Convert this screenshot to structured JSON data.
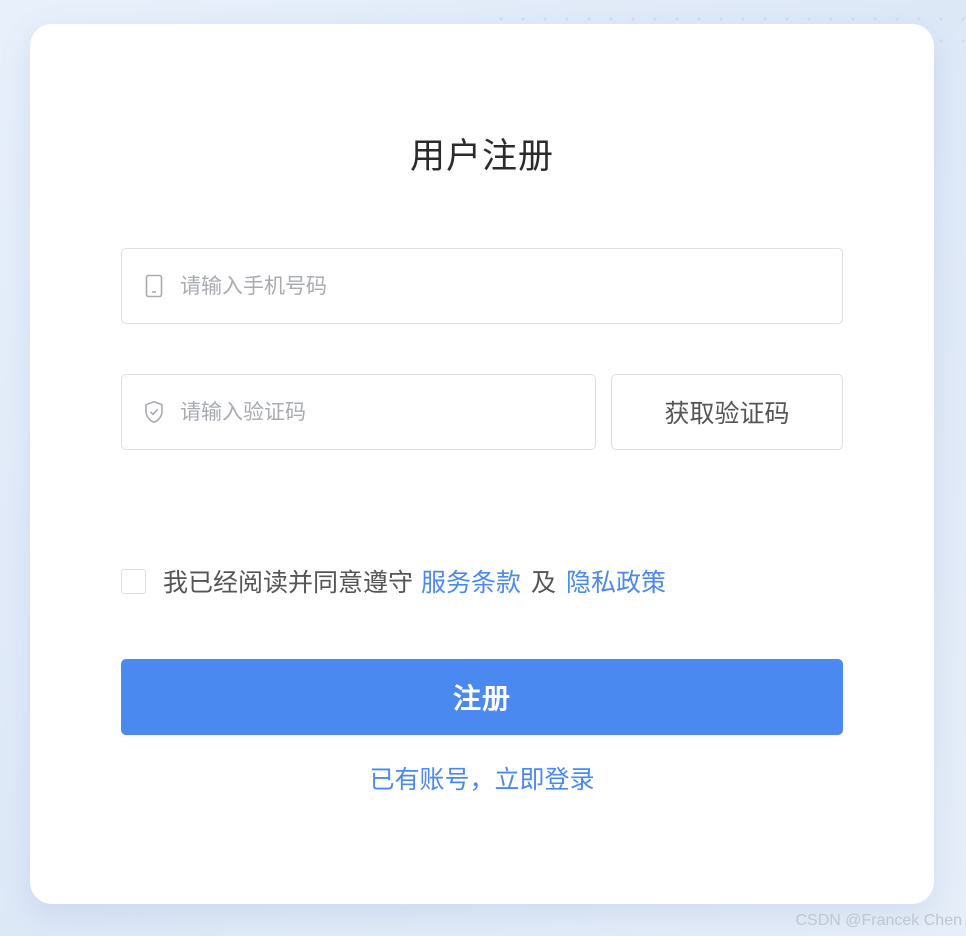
{
  "form": {
    "title": "用户注册",
    "phone": {
      "placeholder": "请输入手机号码",
      "value": "",
      "icon": "phone-icon"
    },
    "code": {
      "placeholder": "请输入验证码",
      "value": "",
      "icon": "shield-icon"
    },
    "get_code_label": "获取验证码",
    "agreement": {
      "checked": false,
      "prefix": "我已经阅读并同意遵守",
      "terms_label": "服务条款",
      "conjunction": "及",
      "privacy_label": "隐私政策"
    },
    "register_label": "注册",
    "login_link_label": "已有账号，立即登录"
  },
  "watermark": "CSDN @Francek Chen",
  "colors": {
    "accent": "#4a89f0",
    "link": "#4a8af0",
    "border": "#dcdfe6",
    "placeholder": "#a8abb2"
  }
}
